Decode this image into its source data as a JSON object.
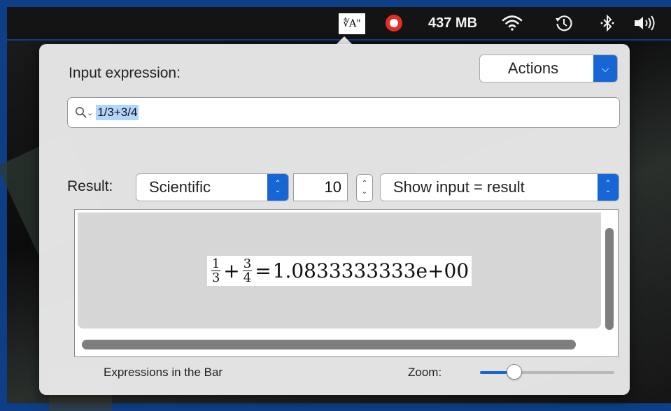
{
  "menubar": {
    "app_icon_text": "∜A\"",
    "record_icon": "record-icon",
    "memory": "437 MB",
    "wifi_icon": "wifi-icon",
    "time_machine_icon": "time-machine-icon",
    "bluetooth_icon": "bluetooth-icon",
    "volume_icon": "volume-icon"
  },
  "popover": {
    "input_label": "Input expression:",
    "actions_label": "Actions",
    "search_value": "1/3+3/4",
    "result_label": "Result:",
    "format_selected": "Scientific",
    "digits": "10",
    "display_selected": "Show input = result",
    "formula": {
      "frac1_num": "1",
      "frac1_den": "3",
      "plus": "+",
      "frac2_num": "3",
      "frac2_den": "4",
      "equals": "=",
      "result": "1.0833333333e+00"
    },
    "footer_label": "Expressions in the Bar",
    "zoom_label": "Zoom:",
    "zoom_level": 0.2
  },
  "colors": {
    "accent": "#1866d6",
    "record": "#e52d27"
  }
}
